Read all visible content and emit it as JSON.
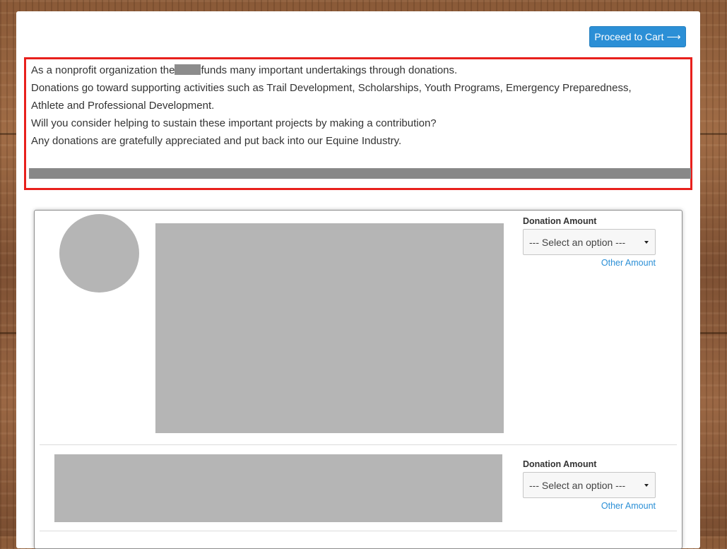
{
  "header": {
    "cart_button_label": "Proceed to Cart",
    "cart_arrow": "⟶"
  },
  "intro": {
    "line1_before": "As a nonprofit organization the",
    "line1_after": "funds many important undertakings through donations.",
    "line2": "Donations go toward supporting activities such as Trail Development, Scholarships, Youth Programs, Emergency Preparedness,",
    "line3": "Athlete and Professional Development.",
    "line4": "Will you consider helping to sustain these important projects by making a contribution?",
    "line5": "Any donations are gratefully appreciated and put back into our Equine Industry."
  },
  "donations": [
    {
      "amount_label": "Donation Amount",
      "select_value": "--- Select an option ---",
      "other_amount_label": "Other Amount"
    },
    {
      "amount_label": "Donation Amount",
      "select_value": "--- Select an option ---",
      "other_amount_label": "Other Amount"
    }
  ],
  "colors": {
    "accent": "#2b8fd6",
    "highlight_border": "#e8201c"
  }
}
